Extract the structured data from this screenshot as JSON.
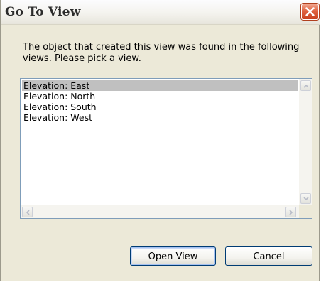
{
  "dialog": {
    "title": "Go To View",
    "message": "The object that created this view was found in the following views.  Please pick a view.",
    "views": [
      {
        "label": "Elevation: East",
        "selected": true
      },
      {
        "label": "Elevation: North",
        "selected": false
      },
      {
        "label": "Elevation: South",
        "selected": false
      },
      {
        "label": "Elevation: West",
        "selected": false
      }
    ],
    "buttons": {
      "open_label": "Open View",
      "cancel_label": "Cancel"
    },
    "icons": {
      "close": "close-icon",
      "scroll_up": "arrow-up-icon",
      "scroll_down": "arrow-down-icon",
      "scroll_left": "arrow-left-icon",
      "scroll_right": "arrow-right-icon"
    },
    "colors": {
      "close_button": "#e0623f",
      "selection": "#c0c0c0",
      "dialog_background": "#ECE9D8",
      "button_border": "#003c74"
    }
  }
}
